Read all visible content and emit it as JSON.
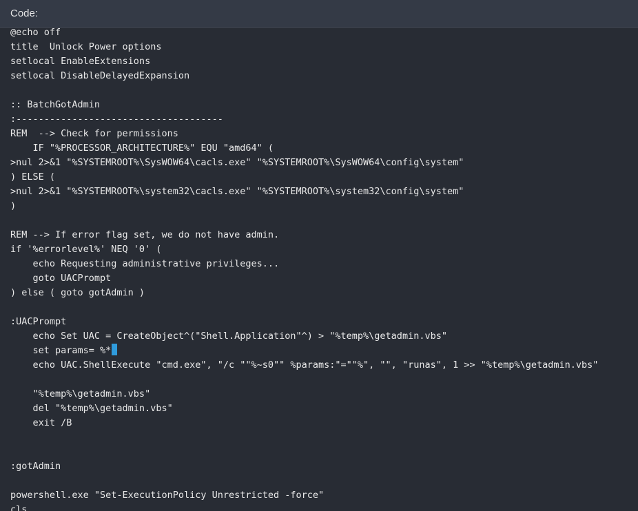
{
  "header": {
    "label": "Code:"
  },
  "colors": {
    "background": "#282c34",
    "header_background": "#343a46",
    "text": "#e8e8e8",
    "cursor": "#2f9bdc"
  },
  "code": {
    "lines": [
      "@echo off",
      "title  Unlock Power options",
      "setlocal EnableExtensions",
      "setlocal DisableDelayedExpansion",
      "",
      ":: BatchGotAdmin",
      ":-------------------------------------",
      "REM  --> Check for permissions",
      "    IF \"%PROCESSOR_ARCHITECTURE%\" EQU \"amd64\" (",
      ">nul 2>&1 \"%SYSTEMROOT%\\SysWOW64\\cacls.exe\" \"%SYSTEMROOT%\\SysWOW64\\config\\system\"",
      ") ELSE (",
      ">nul 2>&1 \"%SYSTEMROOT%\\system32\\cacls.exe\" \"%SYSTEMROOT%\\system32\\config\\system\"",
      ")",
      "",
      "REM --> If error flag set, we do not have admin.",
      "if '%errorlevel%' NEQ '0' (",
      "    echo Requesting administrative privileges...",
      "    goto UACPrompt",
      ") else ( goto gotAdmin )",
      "",
      ":UACPrompt",
      "    echo Set UAC = CreateObject^(\"Shell.Application\"^) > \"%temp%\\getadmin.vbs\"",
      "    set params= %*",
      "    echo UAC.ShellExecute \"cmd.exe\", \"/c \"\"%~s0\"\" %params:\"=\"\"%\", \"\", \"runas\", 1 >> \"%temp%\\getadmin.vbs\"",
      "",
      "    \"%temp%\\getadmin.vbs\"",
      "    del \"%temp%\\getadmin.vbs\"",
      "    exit /B",
      "",
      "",
      ":gotAdmin",
      "",
      "powershell.exe \"Set-ExecutionPolicy Unrestricted -force\"",
      "cls"
    ]
  }
}
